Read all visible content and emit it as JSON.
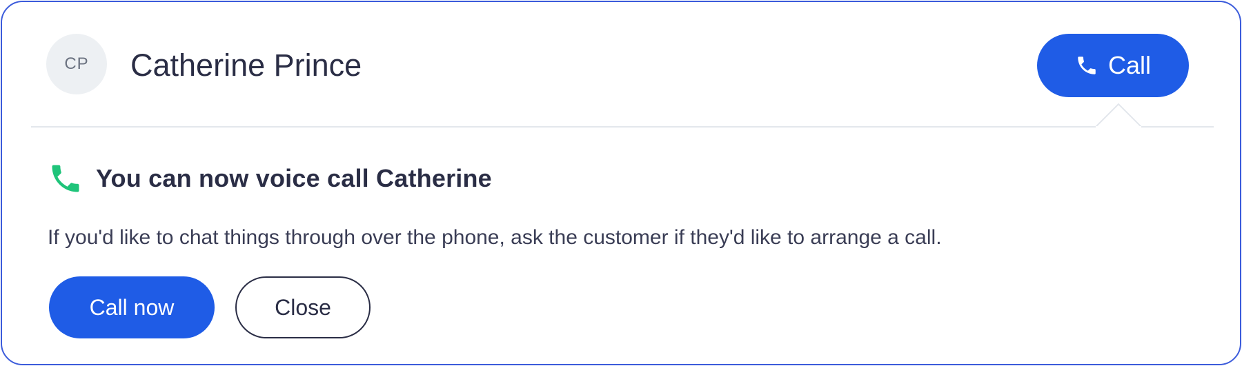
{
  "contact": {
    "initials": "CP",
    "name": "Catherine Prince"
  },
  "header": {
    "call_label": "Call",
    "call_icon": "phone-icon"
  },
  "notice": {
    "icon": "phone-icon",
    "title": "You can now voice call Catherine",
    "body": "If you'd like to chat things through over the phone, ask the customer if they'd like to arrange a call.",
    "primary_label": "Call now",
    "secondary_label": "Close"
  },
  "colors": {
    "accent": "#1f5ce6",
    "border": "#3b5bdb",
    "success": "#1fc47a",
    "text": "#2a2d45"
  }
}
